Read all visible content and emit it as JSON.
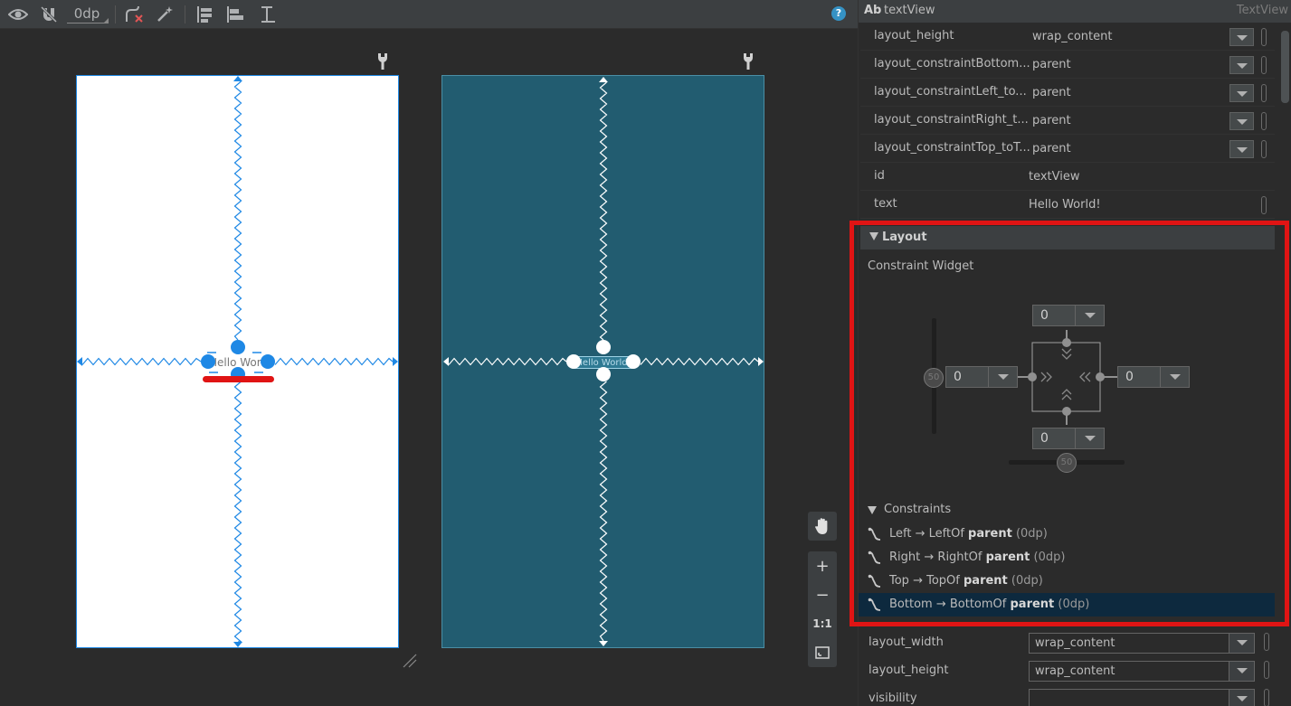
{
  "toolbar": {
    "default_margin": "0dp",
    "help": "?"
  },
  "canvas": {
    "design_text": "Hello World!",
    "blueprint_text": "Hello World!"
  },
  "zoom_panel": {
    "zoom_in": "+",
    "zoom_out": "−",
    "actual_size": "1:1"
  },
  "properties": {
    "icon_label": "Ab",
    "component_name": "textView",
    "component_class": "TextView",
    "rows": [
      {
        "label": "layout_height",
        "value": "wrap_content"
      },
      {
        "label": "layout_constraintBottom...",
        "value": "parent"
      },
      {
        "label": "layout_constraintLeft_to...",
        "value": "parent"
      },
      {
        "label": "layout_constraintRight_t...",
        "value": "parent"
      },
      {
        "label": "layout_constraintTop_toT...",
        "value": "parent"
      },
      {
        "label": "id",
        "value": "textView"
      },
      {
        "label": "text",
        "value": "Hello World!"
      }
    ]
  },
  "layout_section": {
    "title": "Layout",
    "widget_title": "Constraint Widget",
    "margin_top": "0",
    "margin_left": "0",
    "margin_right": "0",
    "margin_bottom": "0",
    "vertical_bias": "50",
    "horizontal_bias": "50",
    "constraints_title": "Constraints",
    "constraints": [
      {
        "side": "Left",
        "arrow": " → ",
        "target": "LeftOf ",
        "parent": "parent",
        "margin": " (0dp)"
      },
      {
        "side": "Right",
        "arrow": " → ",
        "target": "RightOf ",
        "parent": "parent",
        "margin": " (0dp)"
      },
      {
        "side": "Top",
        "arrow": " → ",
        "target": "TopOf ",
        "parent": "parent",
        "margin": " (0dp)"
      },
      {
        "side": "Bottom",
        "arrow": " → ",
        "target": "BottomOf ",
        "parent": "parent",
        "margin": " (0dp)"
      }
    ]
  },
  "fields": [
    {
      "label": "layout_width",
      "value": "wrap_content"
    },
    {
      "label": "layout_height",
      "value": "wrap_content"
    },
    {
      "label": "visibility",
      "value": ""
    }
  ],
  "colors": {
    "accent_blue": "#1e88e5",
    "blueprint": "#225c70",
    "highlight_red": "#e01414",
    "selected_row": "#0d293e"
  }
}
